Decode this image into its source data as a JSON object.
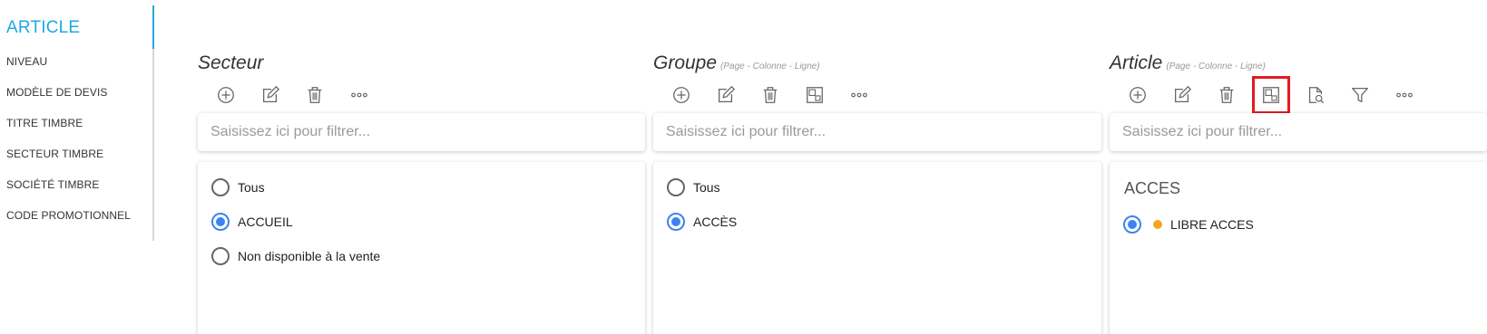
{
  "sidebar": {
    "title": "ARTICLE",
    "items": [
      {
        "label": "NIVEAU"
      },
      {
        "label": "MODÈLE DE DEVIS"
      },
      {
        "label": "TITRE TIMBRE"
      },
      {
        "label": "SECTEUR TIMBRE"
      },
      {
        "label": "SOCIÉTÉ TIMBRE"
      },
      {
        "label": "CODE PROMOTIONNEL"
      }
    ]
  },
  "columns": {
    "secteur": {
      "title": "Secteur",
      "subtitle": "",
      "filter_placeholder": "Saisissez ici pour filtrer...",
      "options": [
        {
          "label": "Tous",
          "checked": false
        },
        {
          "label": "ACCUEIL",
          "checked": true
        },
        {
          "label": "Non disponible à la vente",
          "checked": false
        }
      ]
    },
    "groupe": {
      "title": "Groupe",
      "subtitle": "(Page - Colonne - Ligne)",
      "filter_placeholder": "Saisissez ici pour filtrer...",
      "options": [
        {
          "label": "Tous",
          "checked": false
        },
        {
          "label": "ACCÈS",
          "checked": true
        }
      ]
    },
    "article": {
      "title": "Article",
      "subtitle": "(Page - Colonne - Ligne)",
      "filter_placeholder": "Saisissez ici pour filtrer...",
      "group_heading": "ACCES",
      "options": [
        {
          "label": "LIBRE ACCES",
          "checked": true,
          "status_color": "#f5a623"
        }
      ]
    }
  },
  "colors": {
    "accent": "#1ea7e6",
    "radio_checked": "#3b82f6",
    "highlight": "#e21b23"
  },
  "icons": [
    "add-icon",
    "edit-icon",
    "delete-icon",
    "layout-icon",
    "more-icon",
    "search-document-icon",
    "filter-icon"
  ]
}
